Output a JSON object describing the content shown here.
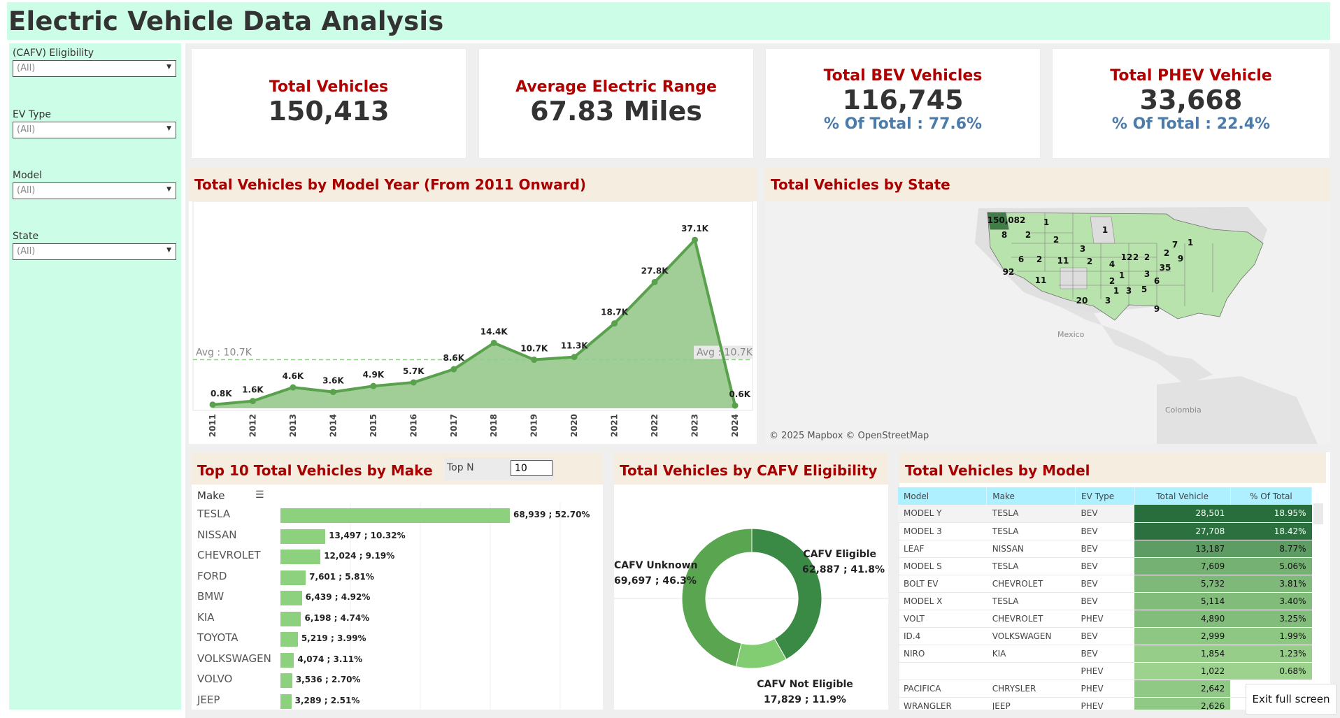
{
  "app": {
    "title": "Electric Vehicle Data Analysis"
  },
  "filters": [
    {
      "label": "(CAFV) Eligibility",
      "value": "(All)"
    },
    {
      "label": "EV Type",
      "value": "(All)"
    },
    {
      "label": "Model",
      "value": "(All)"
    },
    {
      "label": "State",
      "value": "(All)"
    }
  ],
  "kpis": {
    "total_vehicles": {
      "title": "Total Vehicles",
      "value": "150,413"
    },
    "avg_range": {
      "title": "Average Electric Range",
      "value": "67.83 Miles"
    },
    "bev": {
      "title": "Total BEV Vehicles",
      "value": "116,745",
      "pct": "% Of Total :  77.6%"
    },
    "phev": {
      "title": "Total PHEV Vehicle",
      "value": "33,668",
      "pct": "% Of Total : 22.4%"
    }
  },
  "panels": {
    "year": {
      "title": "Total Vehicles by Model Year (From 2011 Onward)"
    },
    "state": {
      "title": "Total Vehicles by State",
      "attribution": "© 2025 Mapbox  © OpenStreetMap",
      "mexico": "Mexico",
      "colombia": "Colombia"
    },
    "make": {
      "title": "Top 10 Total Vehicles by Make",
      "topn_label": "Top N",
      "topn_value": "10",
      "column": "Make"
    },
    "cafv": {
      "title": "Total Vehicles by CAFV Eligibility"
    },
    "model": {
      "title": "Total Vehicles by Model"
    }
  },
  "chart_data": [
    {
      "type": "area",
      "x": [
        "2011",
        "2012",
        "2013",
        "2014",
        "2015",
        "2016",
        "2017",
        "2018",
        "2019",
        "2020",
        "2021",
        "2022",
        "2023",
        "2024"
      ],
      "values": [
        0.8,
        1.6,
        4.6,
        3.6,
        4.9,
        5.7,
        8.6,
        14.4,
        10.7,
        11.3,
        18.7,
        27.8,
        37.1,
        0.6
      ],
      "labels": [
        "0.8K",
        "1.6K",
        "4.6K",
        "3.6K",
        "4.9K",
        "5.7K",
        "8.6K",
        "14.4K",
        "10.7K",
        "11.3K",
        "18.7K",
        "27.8K",
        "37.1K",
        "0.6K"
      ],
      "reference_line": {
        "label": "Avg : 10.7K",
        "value": 10.7
      },
      "ylim": [
        0,
        38.5
      ],
      "color": "#5aa14e",
      "fill": "#9ccb90"
    },
    {
      "type": "bar",
      "orientation": "horizontal",
      "categories": [
        "TESLA",
        "NISSAN",
        "CHEVROLET",
        "FORD",
        "BMW",
        "KIA",
        "TOYOTA",
        "VOLKSWAGEN",
        "VOLVO",
        "JEEP"
      ],
      "values": [
        68939,
        13497,
        12024,
        7601,
        6439,
        6198,
        5219,
        4074,
        3536,
        3289
      ],
      "labels": [
        "68,939 ; 52.70%",
        "13,497 ; 10.32%",
        "12,024 ; 9.19%",
        "7,601 ; 5.81%",
        "6,439 ; 4.92%",
        "6,198 ; 4.74%",
        "5,219 ; 3.99%",
        "4,074 ; 3.11%",
        "3,536 ; 2.70%",
        "3,289 ; 2.51%"
      ],
      "color": "#8dd17f"
    },
    {
      "type": "pie",
      "donut": true,
      "slices": [
        {
          "name": "CAFV Eligible",
          "value": 62887,
          "pct": 41.8,
          "label": "62,887 ; 41.8%",
          "color": "#3a8a45"
        },
        {
          "name": "CAFV Not Eligible",
          "value": 17829,
          "pct": 11.9,
          "label": "17,829 ; 11.9%",
          "color": "#82cd72"
        },
        {
          "name": "CAFV Unknown",
          "value": 69697,
          "pct": 46.3,
          "label": "69,697 ; 46.3%",
          "color": "#5aa54f"
        }
      ]
    },
    {
      "type": "table",
      "columns": [
        "Model",
        "Make",
        "EV Type",
        "Total Vehicle",
        "% Of Total"
      ],
      "rows": [
        [
          "MODEL Y",
          "TESLA",
          "BEV",
          "28,501",
          "18.95%"
        ],
        [
          "MODEL 3",
          "TESLA",
          "BEV",
          "27,708",
          "18.42%"
        ],
        [
          "LEAF",
          "NISSAN",
          "BEV",
          "13,187",
          "8.77%"
        ],
        [
          "MODEL S",
          "TESLA",
          "BEV",
          "7,609",
          "5.06%"
        ],
        [
          "BOLT EV",
          "CHEVROLET",
          "BEV",
          "5,732",
          "3.81%"
        ],
        [
          "MODEL X",
          "TESLA",
          "BEV",
          "5,114",
          "3.40%"
        ],
        [
          "VOLT",
          "CHEVROLET",
          "PHEV",
          "4,890",
          "3.25%"
        ],
        [
          "ID.4",
          "VOLKSWAGEN",
          "BEV",
          "2,999",
          "1.99%"
        ],
        [
          "NIRO",
          "KIA",
          "BEV",
          "1,854",
          "1.23%"
        ],
        [
          "",
          "",
          "PHEV",
          "1,022",
          "0.68%"
        ],
        [
          "PACIFICA",
          "CHRYSLER",
          "PHEV",
          "2,642",
          ""
        ],
        [
          "WRANGLER",
          "JEEP",
          "PHEV",
          "2,626",
          ""
        ]
      ],
      "values": [
        28501,
        27708,
        13187,
        7609,
        5732,
        5114,
        4890,
        2999,
        1854,
        1022,
        2642,
        2626
      ]
    },
    {
      "type": "map",
      "region": "United States",
      "state_values": [
        {
          "state": "WA",
          "value": "150,082"
        },
        {
          "state": "MT",
          "value": "1"
        },
        {
          "state": "OR",
          "value": "8"
        },
        {
          "state": "ID",
          "value": "2"
        },
        {
          "state": "WY",
          "value": "2"
        },
        {
          "state": "MN",
          "value": "1"
        },
        {
          "state": "CA",
          "value": "92"
        },
        {
          "state": "NV",
          "value": "6"
        },
        {
          "state": "UT",
          "value": "2"
        },
        {
          "state": "CO",
          "value": "11"
        },
        {
          "state": "NE",
          "value": "3"
        },
        {
          "state": "KS",
          "value": "2"
        },
        {
          "state": "AZ",
          "value": "11"
        },
        {
          "state": "TX",
          "value": "20"
        },
        {
          "state": "MO",
          "value": "4"
        },
        {
          "state": "IL",
          "value": "12"
        },
        {
          "state": "IN",
          "value": "2"
        },
        {
          "state": "OH",
          "value": "2"
        },
        {
          "state": "PA",
          "value": "2"
        },
        {
          "state": "NY",
          "value": "7"
        },
        {
          "state": "MA",
          "value": "1"
        },
        {
          "state": "NJ",
          "value": "9"
        },
        {
          "state": "MD",
          "value": "35"
        },
        {
          "state": "VA",
          "value": "3"
        },
        {
          "state": "AR",
          "value": "2"
        },
        {
          "state": "TN",
          "value": "1"
        },
        {
          "state": "NC",
          "value": "6"
        },
        {
          "state": "MS",
          "value": "1"
        },
        {
          "state": "AL",
          "value": "3"
        },
        {
          "state": "GA",
          "value": "5"
        },
        {
          "state": "LA",
          "value": "3"
        },
        {
          "state": "FL",
          "value": "9"
        }
      ]
    }
  ],
  "ui": {
    "exit_fullscreen": "Exit full screen"
  }
}
